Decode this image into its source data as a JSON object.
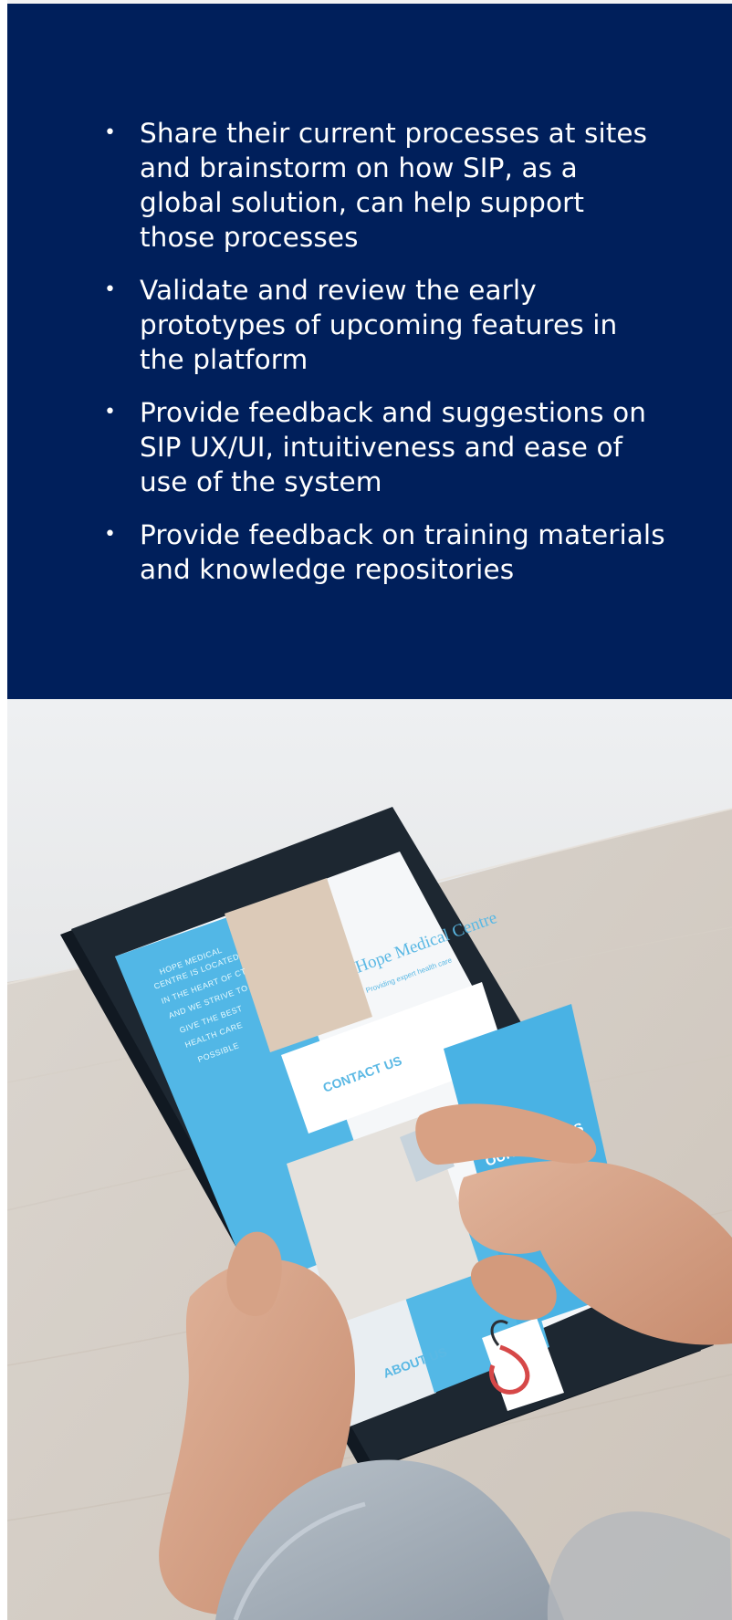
{
  "bullet_section": {
    "items": [
      "Share their current processes at sites and brainstorm on how SIP, as a global solution, can help support those processes",
      "Validate and review the early prototypes of upcoming features in the platform",
      "Provide feedback and suggestions on SIP UX/UI, intuitiveness and ease of use of the system",
      "Provide feedback on training materials and knowledge repositories"
    ]
  },
  "photo": {
    "screen_text": {
      "sidebar_lines": [
        "HOPE MEDICAL",
        "CENTRE IS LOCATED",
        "IN THE HEART OF CT",
        "AND WE STRIVE TO",
        "GIVE THE BEST",
        "HEALTH CARE",
        "POSSIBLE"
      ],
      "brand": "Hope Medical Centre",
      "tagline": "Providing expert health care",
      "contact": "CONTACT US",
      "services": "OUR SERVICES",
      "about": "ABOUT US"
    }
  },
  "colors": {
    "panel_background": "#001f5b",
    "panel_text": "#ffffff",
    "screen_accent": "#53b8e6"
  }
}
